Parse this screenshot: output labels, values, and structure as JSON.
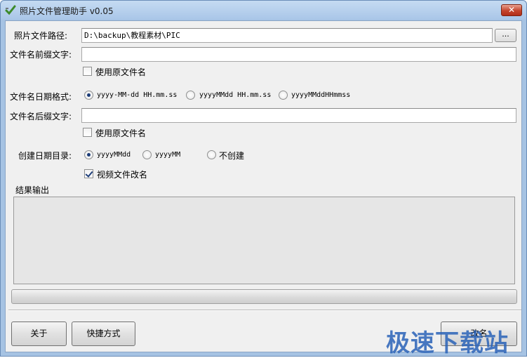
{
  "window": {
    "title": "照片文件管理助手 v0.05",
    "close_label": "✕"
  },
  "form": {
    "photo_path_label": "照片文件路径:",
    "photo_path_value": "D:\\backup\\教程素材\\PIC",
    "browse_label": "...",
    "prefix_label": "文件名前缀文字:",
    "prefix_value": "",
    "prefix_use_original_label": "使用原文件名",
    "prefix_use_original_checked": false,
    "date_format_label": "文件名日期格式:",
    "date_formats": [
      {
        "label": "yyyy-MM-dd HH.mm.ss",
        "selected": true
      },
      {
        "label": "yyyyMMdd HH.mm.ss",
        "selected": false
      },
      {
        "label": "yyyyMMddHHmmss",
        "selected": false
      }
    ],
    "suffix_label": "文件名后缀文字:",
    "suffix_value": "",
    "suffix_use_original_label": "使用原文件名",
    "suffix_use_original_checked": false,
    "date_dir_label": "创建日期目录:",
    "date_dirs": [
      {
        "label": "yyyyMMdd",
        "selected": true
      },
      {
        "label": "yyyyMM",
        "selected": false
      },
      {
        "label": "不创建",
        "selected": false
      }
    ],
    "video_rename_label": "视频文件改名",
    "video_rename_checked": true
  },
  "output": {
    "group_label": "结果输出",
    "text": ""
  },
  "progress": {
    "value": 0
  },
  "buttons": {
    "about_label": "关于",
    "shortcut_label": "快捷方式",
    "rename_label": "改名"
  },
  "watermark": "极速下载站",
  "colors": {
    "title_bar": "#c5dbf2",
    "close_button": "#c4452d",
    "watermark": "#2a63b8"
  }
}
